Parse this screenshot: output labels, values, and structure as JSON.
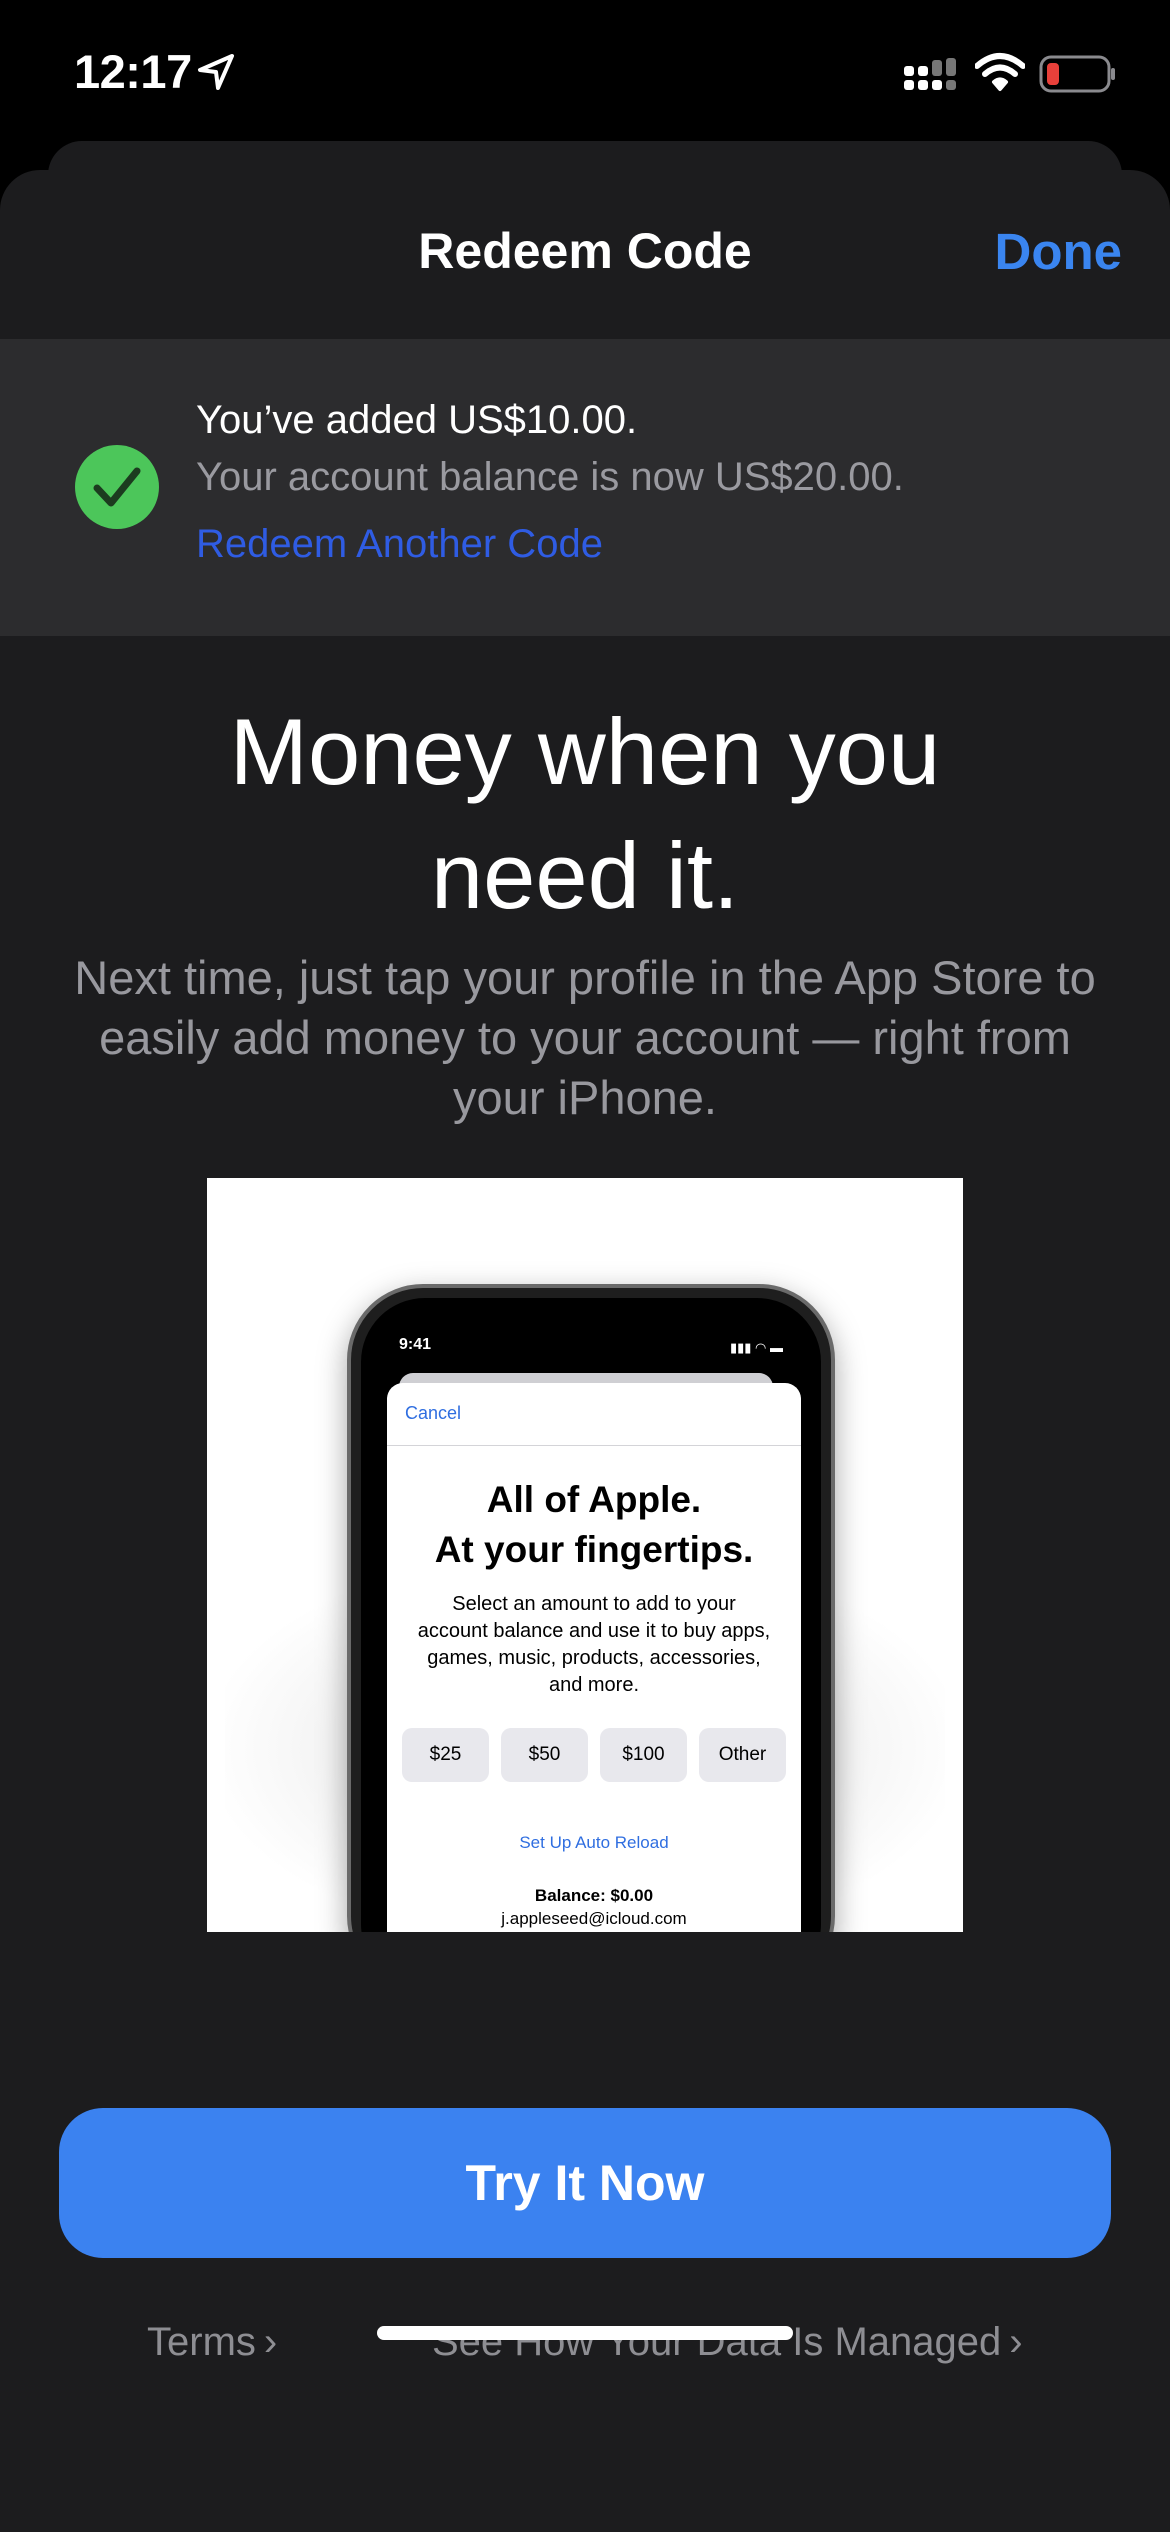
{
  "status_bar": {
    "time": "12:17",
    "battery_color": "#e8403a"
  },
  "nav": {
    "title": "Redeem Code",
    "done_label": "Done",
    "accent": "#3a85f0"
  },
  "banner": {
    "added_text": "You’ve added US$10.00.",
    "balance_text": "Your account balance is now US$20.00.",
    "redeem_another_label": "Redeem Another Code",
    "check_color": "#4cc65a",
    "icon": "checkmark-circle-icon"
  },
  "promo": {
    "headline_line1": "Money when you",
    "headline_line2": "need it.",
    "description": "Next time, just tap your profile in the App Store to easily add money to your account — right from your iPhone.",
    "image": {
      "time": "9:41",
      "cancel_label": "Cancel",
      "headline_line1": "All of Apple.",
      "headline_line2": "At your fingertips.",
      "description": "Select an amount to add to your account balance and use it to buy apps, games, music, products, accessories, and more.",
      "amounts": [
        "$25",
        "$50",
        "$100",
        "Other"
      ],
      "auto_reload_label": "Set Up Auto Reload",
      "balance": "Balance: $0.00",
      "email": "j.appleseed@icloud.com"
    }
  },
  "cta": {
    "label": "Try It Now",
    "color": "#3b82f0"
  },
  "footer": {
    "terms_label": "Terms",
    "data_label": "See How Your Data Is Managed",
    "chevron": "›"
  }
}
